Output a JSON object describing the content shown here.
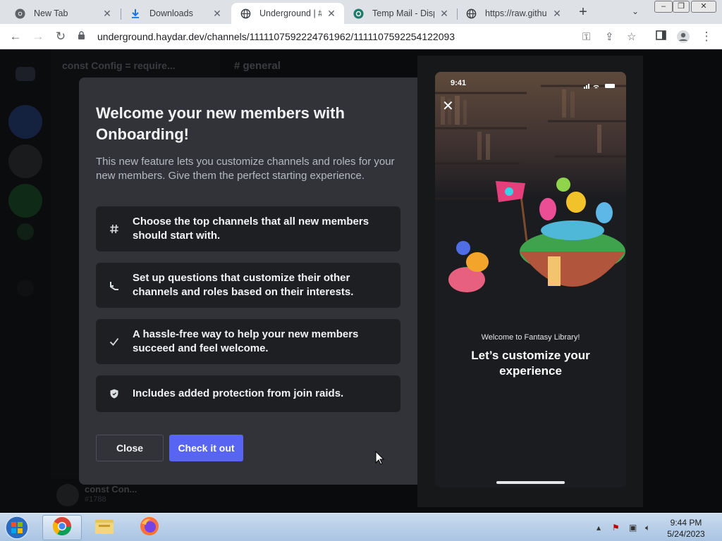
{
  "browser": {
    "tabs": [
      {
        "title": "New Tab",
        "icon": "chrome-icon"
      },
      {
        "title": "Downloads",
        "icon": "download-icon"
      },
      {
        "title": "Underground | #g",
        "icon": "globe-icon"
      },
      {
        "title": "Temp Mail - Dispo",
        "icon": "temp-mail-icon"
      },
      {
        "title": "https://raw.github",
        "icon": "globe-icon"
      }
    ],
    "active_tab": 2,
    "url": "underground.haydar.dev/channels/1111107592224761962/1111107592254122093"
  },
  "discord_background": {
    "server_name": "const Config = require...",
    "channel_name": "general",
    "user_name": "const Con...",
    "user_tag": "#1788"
  },
  "modal": {
    "title": "Welcome your new members with Onboarding!",
    "description": "This new feature lets you customize channels and roles for your new members. Give them the perfect starting experience.",
    "features": [
      {
        "icon": "hash-icon",
        "text": "Choose the top channels that all new members should start with."
      },
      {
        "icon": "questions-icon",
        "text": "Set up questions that customize their other channels and roles based on their interests."
      },
      {
        "icon": "checkmark-icon",
        "text": "A hassle-free way to help your new members succeed and feel welcome."
      },
      {
        "icon": "shield-icon",
        "text": "Includes added protection from join raids."
      }
    ],
    "close_label": "Close",
    "cta_label": "Check it out",
    "accent": "#5865f2"
  },
  "phone_preview": {
    "time": "9:41",
    "welcome_line": "Welcome to Fantasy Library!",
    "headline": "Let’s customize your experience"
  },
  "taskbar": {
    "time": "9:44 PM",
    "date": "5/24/2023"
  }
}
